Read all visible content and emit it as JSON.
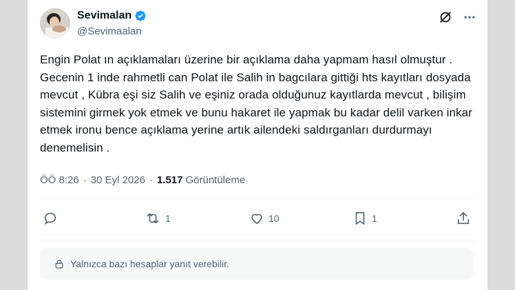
{
  "tweet": {
    "display_name": "Sevimalan",
    "handle": "@Sevimaalan",
    "text": "Engin Polat ın açıklamaları üzerine bir açıklama daha yapmam hasıl olmuştur . Gecenin 1 inde rahmetli can Polat ile Salih in bagcılara gittiği hts kayıtları dosyada mevcut , Kübra eşi siz Salih ve eşiniz orada olduğunuz kayıtlarda mevcut , bilişim sistemini girmek yok etmek ve bunu hakaret ile yapmak bu kadar delil varken inkar etmek ironu bence açıklama yerine artık ailendeki saldırganları durdurmayı denemelisin .",
    "time": "ÖÖ 8:26",
    "date": "30 Eyl 2026",
    "separator": "·",
    "views_count": "1.517",
    "views_label": "Görüntüleme"
  },
  "actions": {
    "reply_count": "",
    "retweet_count": "1",
    "like_count": "10",
    "bookmark_count": "1"
  },
  "reply_restriction": "Yalnızca bazı hesaplar yanıt verebilir.",
  "icons": {
    "verified": "verified-badge-icon",
    "grok": "grok-icon",
    "more": "more-dots-icon",
    "reply": "reply-icon",
    "retweet": "retweet-icon",
    "like": "heart-icon",
    "bookmark": "bookmark-icon",
    "share": "share-icon",
    "lock": "lock-icon"
  },
  "colors": {
    "verified": "#1d9bf0",
    "text": "#0f1419",
    "secondary": "#536471",
    "notice_bg": "#f7f9f9"
  }
}
